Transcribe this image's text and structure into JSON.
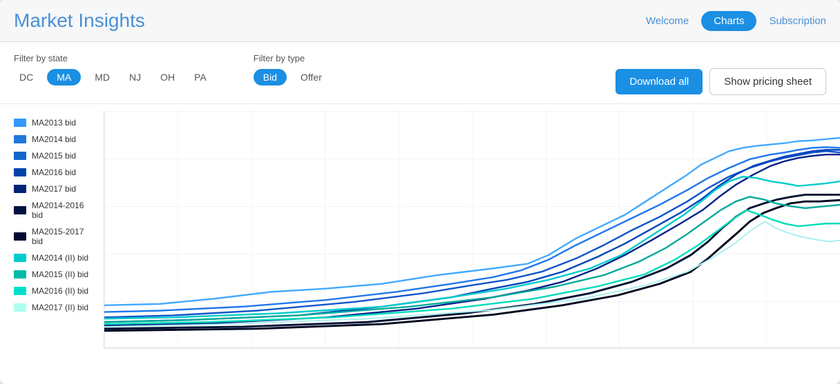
{
  "app": {
    "title_part1": "Market",
    "title_part2": "Insights"
  },
  "nav": {
    "welcome_label": "Welcome",
    "charts_label": "Charts",
    "subscription_label": "Subscription"
  },
  "filters": {
    "state_label": "Filter by state",
    "states": [
      "DC",
      "MA",
      "MD",
      "NJ",
      "OH",
      "PA"
    ],
    "active_state": "MA",
    "type_label": "Filter by type",
    "types": [
      "Bid",
      "Offer"
    ],
    "active_type": "Bid"
  },
  "buttons": {
    "download_all": "Download all",
    "show_pricing": "Show pricing sheet"
  },
  "legend": [
    {
      "id": "ma2013",
      "label": "MA2013 bid",
      "color": "#3399ff"
    },
    {
      "id": "ma2014",
      "label": "MA2014 bid",
      "color": "#2277dd"
    },
    {
      "id": "ma2015",
      "label": "MA2015 bid",
      "color": "#1166cc"
    },
    {
      "id": "ma2016",
      "label": "MA2016 bid",
      "color": "#0055bb"
    },
    {
      "id": "ma2017",
      "label": "MA2017 bid",
      "color": "#002266"
    },
    {
      "id": "ma2014_2016",
      "label": "MA2014-2016 bid",
      "color": "#001144"
    },
    {
      "id": "ma2015_2017",
      "label": "MA2015-2017 bid",
      "color": "#000833"
    },
    {
      "id": "ma2014_ii",
      "label": "MA2014 (II) bid",
      "color": "#00cccc"
    },
    {
      "id": "ma2015_ii",
      "label": "MA2015 (II) bid",
      "color": "#00bbaa"
    },
    {
      "id": "ma2016_ii",
      "label": "MA2016 (II) bid",
      "color": "#00ddbb"
    },
    {
      "id": "ma2017_ii",
      "label": "MA2017 (II) bid",
      "color": "#aaffee"
    }
  ]
}
